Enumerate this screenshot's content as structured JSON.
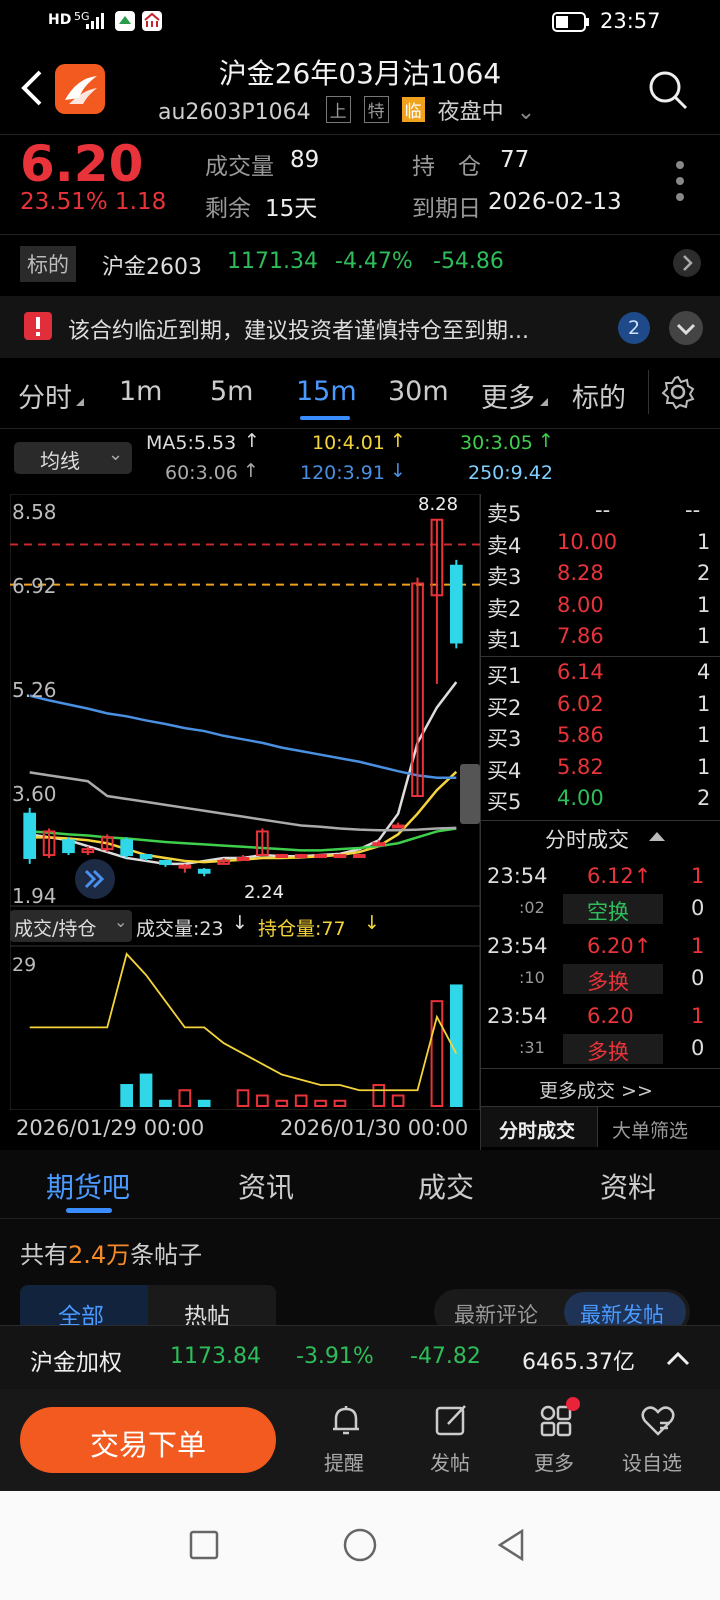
{
  "status_bar": {
    "left_icons": [
      "HD",
      "5G"
    ],
    "time": "23:57",
    "battery_icon": "battery-icon"
  },
  "header": {
    "title": "沪金26年03月沽1064",
    "code": "au2603P1064",
    "tags": [
      "上",
      "特",
      "临"
    ],
    "session": "夜盘中"
  },
  "quote": {
    "price": "6.20",
    "change_pct": "23.51%",
    "change": "1.18",
    "volume_label": "成交量",
    "volume": "89",
    "remain_label": "剩余",
    "remain": "15天",
    "hold_label": "持　仓",
    "hold": "77",
    "expire_label": "到期日",
    "expire": "2026-02-13"
  },
  "underlying": {
    "tag": "标的",
    "name": "沪金2603",
    "price": "1171.34",
    "pct": "-4.47%",
    "change": "-54.86"
  },
  "notice": {
    "text": "该合约临近到期，建议投资者谨慎持仓至到期...",
    "count": "2"
  },
  "period_tabs": [
    "分时",
    "1m",
    "5m",
    "15m",
    "30m",
    "更多",
    "标的"
  ],
  "active_tab": "15m",
  "ma": {
    "selector": "均线",
    "ma5": "MA5:5.53",
    "ma10": "10:4.01",
    "ma30": "30:3.05",
    "ma60": "60:3.06",
    "ma120": "120:3.91",
    "ma250": "250:9.42",
    "ma5_color": "#dddddd",
    "ma10_color": "#f5d33a",
    "ma30_color": "#3ecf4c",
    "ma60_color": "#aaaaaa",
    "ma120_color": "#4a8fe0",
    "ma250_color": "#7fd0ff"
  },
  "chart_labels": {
    "y_ticks": [
      "8.58",
      "6.92",
      "5.26",
      "3.60",
      "1.94"
    ],
    "high": "8.28",
    "low": "2.24",
    "vol_top": "29",
    "x_ticks": [
      "2026/01/29 00:00",
      "2026/01/30 00:00"
    ]
  },
  "sub_chart": {
    "selector": "成交/持仓",
    "vol_label": "成交量:23",
    "oi_label": "持仓量:77"
  },
  "order_book": {
    "asks": [
      {
        "label": "卖5",
        "price": "--",
        "qty": "--"
      },
      {
        "label": "卖4",
        "price": "10.00",
        "qty": "1"
      },
      {
        "label": "卖3",
        "price": "8.28",
        "qty": "2"
      },
      {
        "label": "卖2",
        "price": "8.00",
        "qty": "1"
      },
      {
        "label": "卖1",
        "price": "7.86",
        "qty": "1"
      }
    ],
    "bids": [
      {
        "label": "买1",
        "price": "6.14",
        "qty": "4"
      },
      {
        "label": "买2",
        "price": "6.02",
        "qty": "1"
      },
      {
        "label": "买3",
        "price": "5.86",
        "qty": "1"
      },
      {
        "label": "买4",
        "price": "5.82",
        "qty": "1"
      },
      {
        "label": "买5",
        "price": "4.00",
        "qty": "2"
      }
    ]
  },
  "trades": {
    "title": "分时成交",
    "items": [
      {
        "time": "23:54",
        "sec": ":02",
        "price": "6.12",
        "qty": "1",
        "kind": "空换",
        "kqty": "0"
      },
      {
        "time": "23:54",
        "sec": ":10",
        "price": "6.20",
        "qty": "1",
        "kind": "多换",
        "kqty": "0"
      },
      {
        "time": "23:54",
        "sec": ":31",
        "price": "6.20",
        "qty": "1",
        "kind": "多换",
        "kqty": "0"
      }
    ],
    "more": "更多成交 >>",
    "tab1": "分时成交",
    "tab2": "大单筛选"
  },
  "bottom_tabs": [
    "期货吧",
    "资讯",
    "成交",
    "资料"
  ],
  "forum": {
    "prefix": "共有",
    "count": "2.4万",
    "suffix": "条帖子",
    "sub_tabs": [
      "全部",
      "热帖"
    ],
    "sorts": [
      "最新评论",
      "最新发帖"
    ]
  },
  "ticker": {
    "name": "沪金加权",
    "price": "1173.84",
    "pct": "-3.91%",
    "change": "-47.82",
    "amount": "6465.37亿"
  },
  "actions": {
    "trade": "交易下单",
    "remind": "提醒",
    "post": "发帖",
    "more": "更多",
    "watch": "设自选"
  },
  "chart_data": {
    "type": "candlestick",
    "y_range": [
      1.94,
      8.58
    ],
    "x_ticks": [
      "2026/01/29 00:00",
      "2026/01/30 00:00"
    ],
    "candles": [
      {
        "o": 3.3,
        "c": 2.55,
        "h": 3.4,
        "l": 2.45
      },
      {
        "o": 2.6,
        "c": 3.0,
        "h": 3.05,
        "l": 2.55
      },
      {
        "o": 2.85,
        "c": 2.65,
        "h": 2.9,
        "l": 2.6
      },
      {
        "o": 2.65,
        "c": 2.7,
        "h": 2.75,
        "l": 2.6
      },
      {
        "o": 2.7,
        "c": 2.9,
        "h": 2.95,
        "l": 2.65
      },
      {
        "o": 2.85,
        "c": 2.6,
        "h": 2.9,
        "l": 2.55
      },
      {
        "o": 2.6,
        "c": 2.55,
        "h": 2.62,
        "l": 2.5
      },
      {
        "o": 2.5,
        "c": 2.45,
        "h": 2.52,
        "l": 2.4
      },
      {
        "o": 2.4,
        "c": 2.42,
        "h": 2.45,
        "l": 2.3
      },
      {
        "o": 2.35,
        "c": 2.3,
        "h": 2.38,
        "l": 2.24
      },
      {
        "o": 2.45,
        "c": 2.5,
        "h": 2.55,
        "l": 2.45
      },
      {
        "o": 2.55,
        "c": 2.55,
        "h": 2.6,
        "l": 2.5
      },
      {
        "o": 2.6,
        "c": 3.0,
        "h": 3.05,
        "l": 2.6
      },
      {
        "o": 2.6,
        "c": 2.6,
        "h": 2.62,
        "l": 2.55
      },
      {
        "o": 2.6,
        "c": 2.6,
        "h": 2.62,
        "l": 2.58
      },
      {
        "o": 2.6,
        "c": 2.6,
        "h": 2.62,
        "l": 2.58
      },
      {
        "o": 2.6,
        "c": 2.6,
        "h": 2.62,
        "l": 2.58
      },
      {
        "o": 2.6,
        "c": 2.6,
        "h": 2.62,
        "l": 2.58
      },
      {
        "o": 2.8,
        "c": 2.8,
        "h": 2.85,
        "l": 2.75
      },
      {
        "o": 3.1,
        "c": 3.1,
        "h": 3.15,
        "l": 3.05
      },
      {
        "o": 3.6,
        "c": 7.2,
        "h": 7.3,
        "l": 3.6
      },
      {
        "o": 7.0,
        "c": 8.28,
        "h": 8.28,
        "l": 5.5
      },
      {
        "o": 7.5,
        "c": 6.2,
        "h": 7.6,
        "l": 6.1
      }
    ],
    "ma_series": [
      {
        "name": "MA5",
        "values": [
          2.95,
          2.9,
          2.85,
          2.75,
          2.65,
          2.55,
          2.5,
          2.45,
          2.45,
          2.5,
          2.55,
          2.55,
          2.6,
          2.58,
          2.58,
          2.6,
          2.62,
          2.7,
          2.85,
          3.3,
          4.5,
          5.1,
          5.53
        ]
      },
      {
        "name": "10",
        "values": [
          2.9,
          2.9,
          2.88,
          2.85,
          2.8,
          2.7,
          2.6,
          2.55,
          2.5,
          2.48,
          2.5,
          2.52,
          2.55,
          2.55,
          2.56,
          2.58,
          2.6,
          2.65,
          2.75,
          2.95,
          3.3,
          3.7,
          4.01
        ]
      },
      {
        "name": "30",
        "values": [
          3.0,
          2.98,
          2.95,
          2.93,
          2.9,
          2.88,
          2.85,
          2.82,
          2.8,
          2.78,
          2.76,
          2.74,
          2.72,
          2.7,
          2.68,
          2.68,
          2.7,
          2.72,
          2.75,
          2.8,
          2.9,
          3.0,
          3.05
        ]
      },
      {
        "name": "60",
        "values": [
          4.0,
          3.95,
          3.9,
          3.85,
          3.6,
          3.55,
          3.5,
          3.45,
          3.4,
          3.35,
          3.3,
          3.25,
          3.2,
          3.15,
          3.1,
          3.08,
          3.05,
          3.03,
          3.02,
          3.02,
          3.03,
          3.05,
          3.06
        ]
      },
      {
        "name": "120",
        "values": [
          5.3,
          5.22,
          5.15,
          5.08,
          5.0,
          4.95,
          4.88,
          4.82,
          4.75,
          4.7,
          4.62,
          4.56,
          4.5,
          4.42,
          4.36,
          4.3,
          4.24,
          4.18,
          4.1,
          4.02,
          3.95,
          3.91,
          3.91
        ]
      }
    ],
    "volume": [
      0,
      0,
      0,
      0,
      0,
      4,
      6,
      1,
      3,
      1,
      0,
      3,
      2,
      1,
      2,
      1,
      1,
      0,
      4,
      2,
      0,
      20,
      23
    ],
    "open_interest": [
      15,
      15,
      15,
      15,
      15,
      29,
      25,
      20,
      15,
      15,
      12,
      10,
      8,
      6,
      5,
      4,
      4,
      3,
      3,
      3,
      3,
      17,
      10
    ]
  }
}
